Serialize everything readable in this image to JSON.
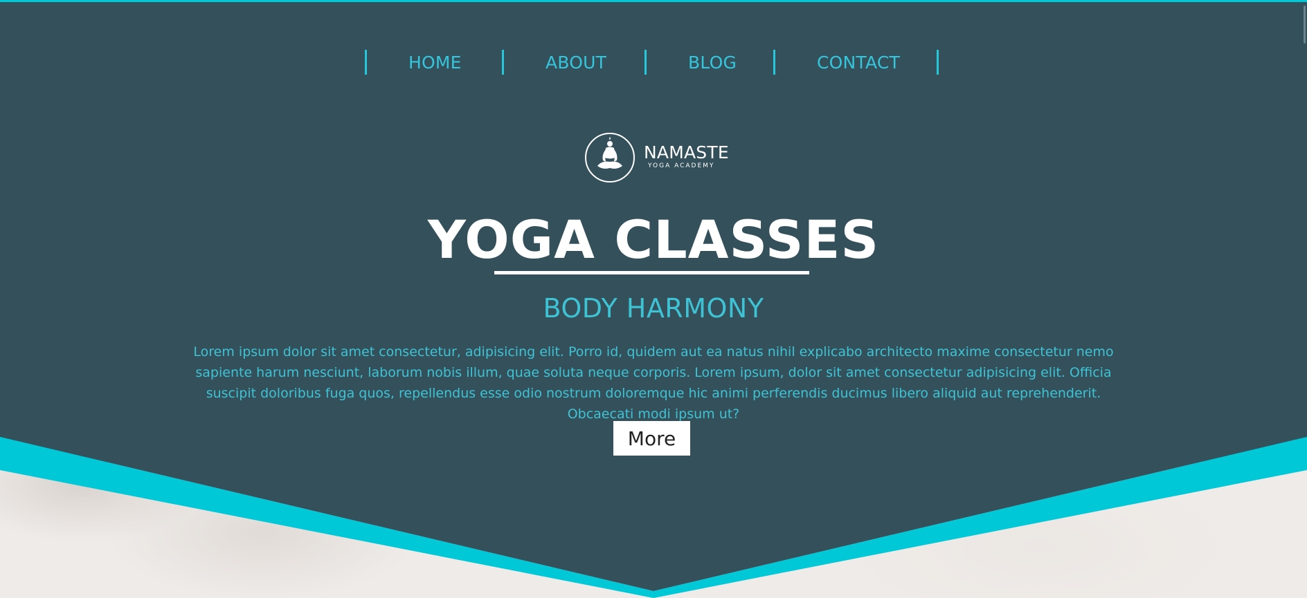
{
  "colors": {
    "hero_bg": "#34505b",
    "accent": "#00c8d7",
    "nav_text": "#34c6dc",
    "white": "#ffffff"
  },
  "nav": {
    "items": [
      {
        "label": "HOME"
      },
      {
        "label": "ABOUT"
      },
      {
        "label": "BLOG"
      },
      {
        "label": "CONTACT"
      }
    ]
  },
  "logo": {
    "name": "NAMASTE",
    "subtitle": "YOGA ACADEMY",
    "icon": "meditation-figure-icon"
  },
  "hero": {
    "title": "YOGA CLASSES",
    "subtitle": "BODY HARMONY",
    "text": "Lorem ipsum dolor sit amet consectetur, adipisicing elit. Porro id, quidem aut ea natus nihil explicabo architecto maxime consectetur nemo sapiente harum nesciunt, laborum nobis illum, quae soluta neque corporis. Lorem ipsum, dolor sit amet consectetur adipisicing elit. Officia suscipit doloribus fuga quos, repellendus esse odio nostrum doloremque hic animi perferendis ducimus libero aliquid aut reprehenderit. Obcaecati modi ipsum ut?",
    "button_label": "More"
  }
}
